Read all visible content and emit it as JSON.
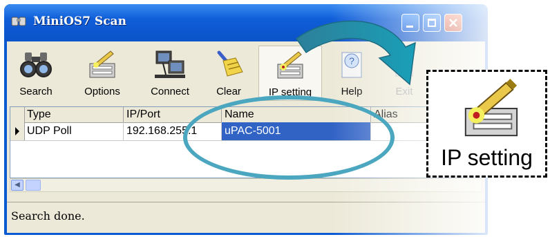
{
  "window": {
    "title": "MiniOS7 Scan"
  },
  "toolbar": {
    "items": [
      {
        "label": "Search",
        "icon": "binoculars-icon"
      },
      {
        "label": "Options",
        "icon": "options-icon"
      },
      {
        "label": "Connect",
        "icon": "computers-icon"
      },
      {
        "label": "Clear",
        "icon": "broom-icon"
      },
      {
        "label": "IP setting",
        "icon": "ip-setting-icon"
      },
      {
        "label": "Help",
        "icon": "help-icon"
      },
      {
        "label": "Exit",
        "icon": "exit-icon"
      }
    ]
  },
  "grid": {
    "columns": [
      "Type",
      "IP/Port",
      "Name",
      "Alias"
    ],
    "rows": [
      {
        "type": "UDP Poll",
        "ip_port": "192.168.255.1",
        "name": "uPAC-5001",
        "alias": ""
      }
    ]
  },
  "status": {
    "text": "Search done."
  },
  "callout": {
    "label": "IP setting"
  },
  "colors": {
    "titlebar": "#0b53c8",
    "selection": "#3163c5",
    "highlight_ellipse": "#4ba6bf",
    "arrow": "#2a9ab0"
  }
}
